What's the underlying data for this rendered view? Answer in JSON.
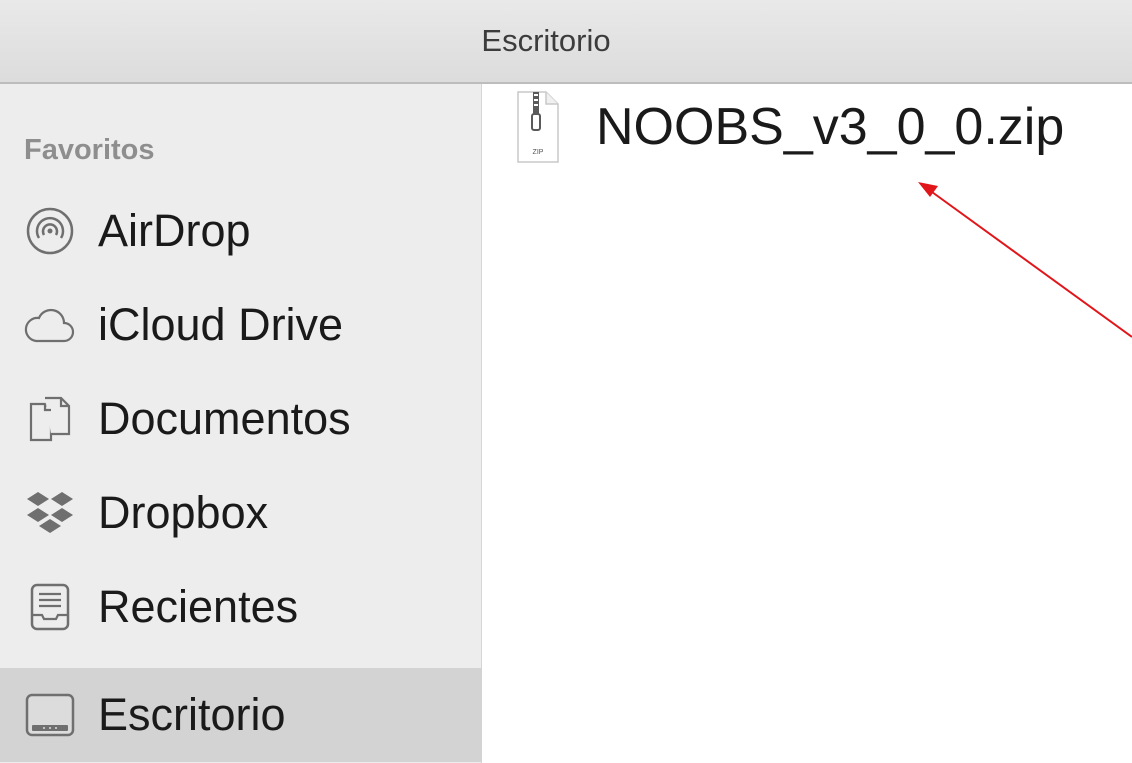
{
  "window": {
    "title": "Escritorio"
  },
  "sidebar": {
    "section_title": "Favoritos",
    "items": [
      {
        "label": "AirDrop",
        "icon": "airdrop-icon"
      },
      {
        "label": "iCloud Drive",
        "icon": "cloud-icon"
      },
      {
        "label": "Documentos",
        "icon": "documents-icon"
      },
      {
        "label": "Dropbox",
        "icon": "dropbox-icon"
      },
      {
        "label": "Recientes",
        "icon": "recents-icon"
      },
      {
        "label": "Escritorio",
        "icon": "desktop-icon",
        "selected": true
      }
    ]
  },
  "content": {
    "files": [
      {
        "name": "NOOBS_v3_0_0.zip",
        "icon": "zip-file-icon",
        "icon_label": "ZIP"
      }
    ]
  },
  "colors": {
    "annotation_arrow": "#e0161b",
    "sidebar_background": "#ededed",
    "selected_background": "#d3d3d3"
  }
}
